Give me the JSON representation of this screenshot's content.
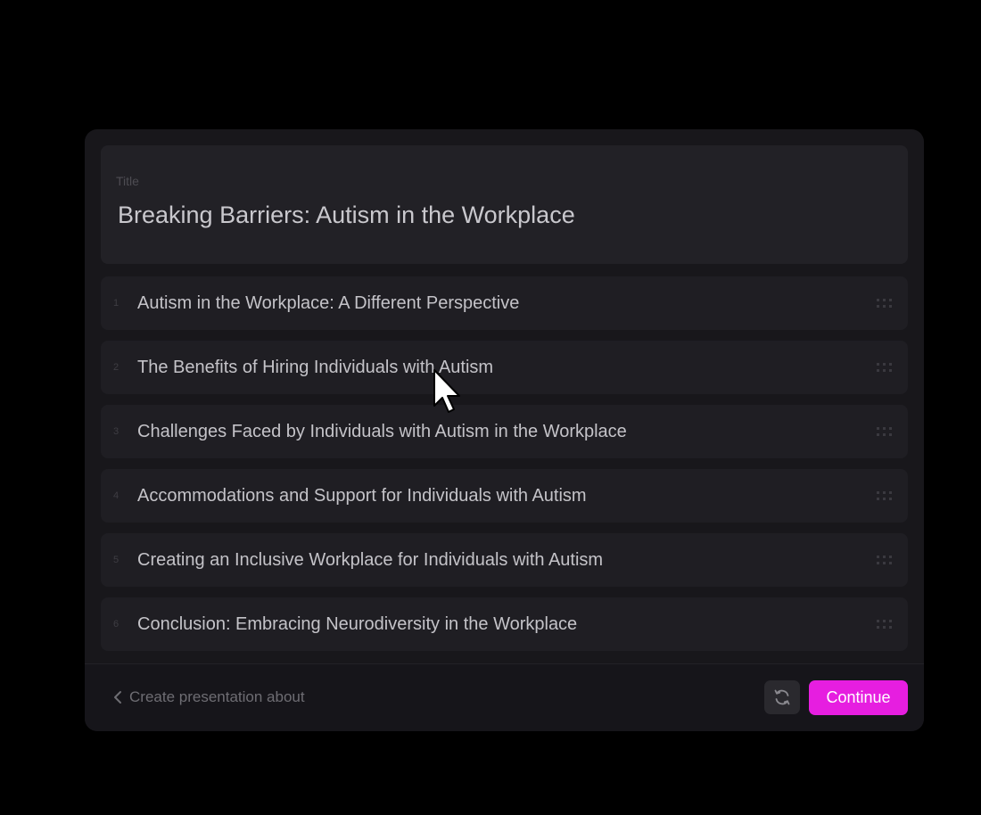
{
  "title_card": {
    "label": "Title",
    "value": "Breaking Barriers: Autism in the Workplace"
  },
  "outline": {
    "items": [
      {
        "number": "1",
        "label": "Autism in the Workplace: A Different Perspective"
      },
      {
        "number": "2",
        "label": "The Benefits of Hiring Individuals with Autism"
      },
      {
        "number": "3",
        "label": "Challenges Faced by Individuals with Autism in the Workplace"
      },
      {
        "number": "4",
        "label": "Accommodations and Support for Individuals with Autism"
      },
      {
        "number": "5",
        "label": "Creating an Inclusive Workplace for Individuals with Autism"
      },
      {
        "number": "6",
        "label": "Conclusion: Embracing Neurodiversity in the Workplace"
      }
    ]
  },
  "footer": {
    "back_label": "Create presentation about",
    "back_icon": "chevron-left-icon",
    "refresh_icon": "refresh-icon",
    "continue_label": "Continue"
  },
  "colors": {
    "background": "#000000",
    "panel": "#18171b",
    "card": "#222126",
    "accent": "#e61ee0"
  }
}
